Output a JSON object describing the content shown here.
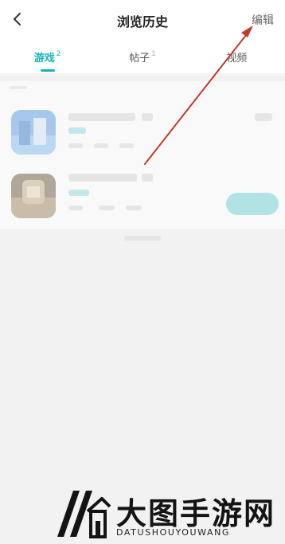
{
  "header": {
    "title": "浏览历史",
    "edit_label": "编辑"
  },
  "tabs": [
    {
      "label": "游戏",
      "count": "2",
      "active": true
    },
    {
      "label": "帖子",
      "count": "1",
      "active": false
    },
    {
      "label": "视频",
      "count": "",
      "active": false
    }
  ],
  "watermark": {
    "title": "大图手游网",
    "subtitle": "DATUSHOUYOUWANG"
  },
  "colors": {
    "accent": "#14b2b8",
    "annotation_arrow": "#c0392b"
  }
}
